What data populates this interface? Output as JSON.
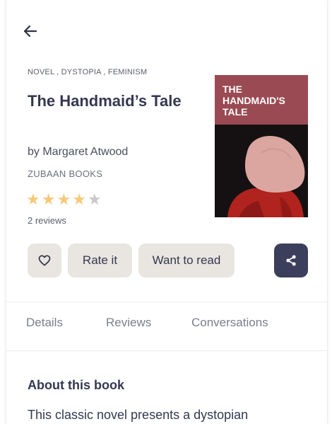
{
  "book": {
    "genres": "NOVEL , DYSTOPIA , FEMINISM",
    "title": "The Handmaid’s Tale",
    "author": "by Margaret Atwood",
    "publisher": "ZUBAAN BOOKS",
    "rating": 4,
    "rating_max": 5,
    "reviews_count": "2 reviews",
    "cover_title": "THE HANDMAID'S TALE"
  },
  "actions": {
    "rate_label": "Rate it",
    "want_label": "Want to read"
  },
  "tabs": [
    {
      "label": "Details"
    },
    {
      "label": "Reviews"
    },
    {
      "label": "Conversations"
    }
  ],
  "about": {
    "heading": "About this book",
    "text": "This classic novel presents a dystopian"
  },
  "icons": {
    "back": "arrow-left-icon",
    "like": "heart-outline-icon",
    "share": "share-icon"
  },
  "colors": {
    "star_filled": "#f5c97a",
    "star_empty": "#c9c9c9",
    "share_button": "#3b3f5c",
    "button_bg": "#e9e5e0",
    "cover_red": "#9a4a52"
  }
}
